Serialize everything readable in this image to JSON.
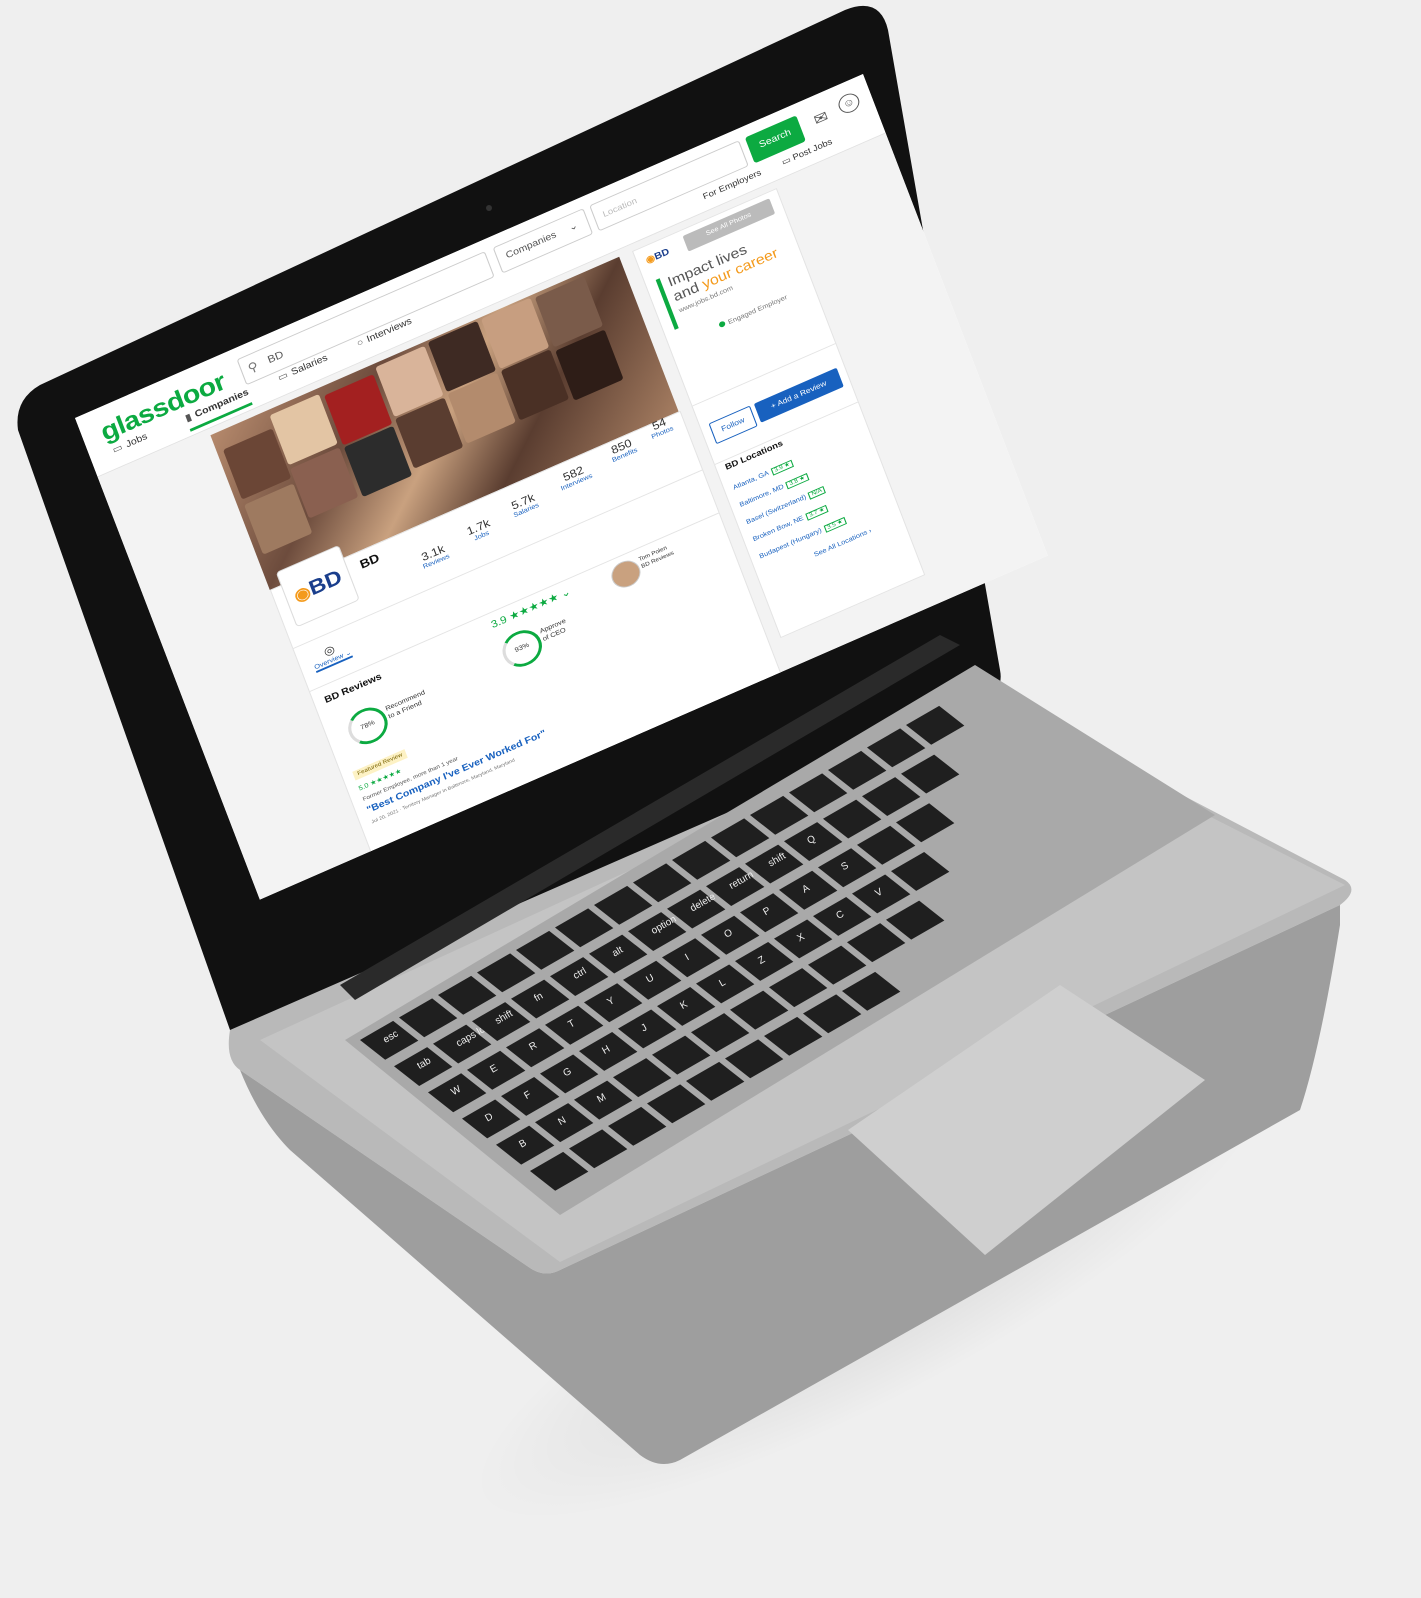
{
  "header": {
    "logo": "glassdoor",
    "search_value": "BD",
    "category_value": "Companies",
    "location_placeholder": "Location",
    "search_button": "Search",
    "nav": [
      {
        "label": "Jobs"
      },
      {
        "label": "Companies"
      },
      {
        "label": "Salaries"
      },
      {
        "label": "Interviews"
      }
    ],
    "for_employers": "For Employers",
    "post_jobs": "Post Jobs"
  },
  "ad": {
    "logo": "BD",
    "button": "See All Photos",
    "headline_1": "Impact lives",
    "headline_2a": "and ",
    "headline_2b": "your career",
    "url": "www.jobs.bd.com",
    "engaged": "Engaged Employer"
  },
  "company": {
    "logo": "BD",
    "name": "BD",
    "stats": [
      {
        "value": "3.1k",
        "label": "Reviews"
      },
      {
        "value": "1.7k",
        "label": "Jobs"
      },
      {
        "value": "5.7k",
        "label": "Salaries"
      },
      {
        "value": "582",
        "label": "Interviews"
      },
      {
        "value": "850",
        "label": "Benefits"
      },
      {
        "value": "54",
        "label": "Photos"
      }
    ],
    "follow": "Follow",
    "add_review": "+ Add a Review"
  },
  "tabs": {
    "overview": "Overview"
  },
  "reviews": {
    "title": "BD Reviews",
    "rating": "3.9",
    "stars": "★★★★★",
    "recommend_pct": "78%",
    "recommend_label_1": "Recommend",
    "recommend_label_2": "to a Friend",
    "ceo_pct": "93%",
    "ceo_label_1": "Approve",
    "ceo_label_2": "of CEO",
    "ceo_name": "Tom Polen",
    "ceo_title": "BD Reviews",
    "featured": "Featured Review",
    "rev_rating": "5.0 ★★★★★",
    "rev_meta": "Former Employee, more than 1 year",
    "rev_headline": "\"Best Company I've Ever Worked For\"",
    "rev_sub": "Jul 20, 2021 · Territory Manager in Baltimore, Maryland, Maryland"
  },
  "locations": {
    "title": "BD Locations",
    "items": [
      {
        "name": "Atlanta, GA",
        "rating": "3.9 ★"
      },
      {
        "name": "Baltimore, MD",
        "rating": "3.8 ★"
      },
      {
        "name": "Basel (Switzerland)",
        "rating": "N/A"
      },
      {
        "name": "Broken Bow, NE",
        "rating": "3.7 ★"
      },
      {
        "name": "Budapest (Hungary)",
        "rating": "3.5 ★"
      }
    ],
    "see_all": "See All Locations"
  },
  "keyboard": {
    "keys": [
      "esc",
      "tab",
      "caps lock",
      "shift",
      "fn",
      "ctrl",
      "alt",
      "option",
      "delete",
      "return",
      "shift",
      "Q",
      "W",
      "E",
      "R",
      "T",
      "Y",
      "U",
      "I",
      "O",
      "P",
      "A",
      "S",
      "D",
      "F",
      "G",
      "H",
      "J",
      "K",
      "L",
      "Z",
      "X",
      "C",
      "V",
      "B",
      "N",
      "M"
    ]
  }
}
